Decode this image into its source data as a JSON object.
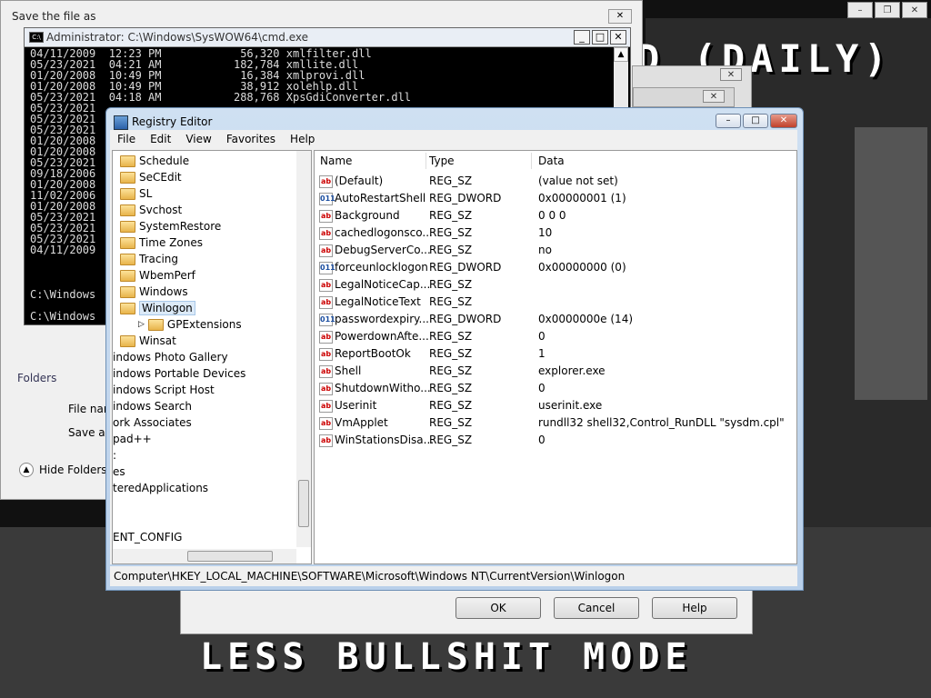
{
  "game": {
    "title_text": "D (DAILY)",
    "bottom_text": "LESS BULLSHIT MODE"
  },
  "save_dialog": {
    "title": "Save the file as",
    "close": "✕",
    "folders": "Folders",
    "file_name_label": "File name:",
    "save_type_label": "Save as type:",
    "hide_folders": "Hide Folders"
  },
  "cmd": {
    "title": "Administrator: C:\\Windows\\SysWOW64\\cmd.exe",
    "lines": [
      "04/11/2009  12:23 PM            56,320 xmlfilter.dll",
      "05/23/2021  04:21 AM           182,784 xmllite.dll",
      "01/20/2008  10:49 PM            16,384 xmlprovi.dll",
      "01/20/2008  10:49 PM            38,912 xolehlp.dll",
      "05/23/2021  04:18 AM           288,768 XpsGdiConverter.dll",
      "05/23/2021",
      "05/23/2021",
      "05/23/2021",
      "01/20/2008",
      "01/20/2008",
      "05/23/2021",
      "09/18/2006",
      "01/20/2008",
      "11/02/2006",
      "01/20/2008",
      "05/23/2021",
      "05/23/2021",
      "05/23/2021",
      "04/11/2009"
    ],
    "prompt1": "C:\\Windows",
    "prompt2": "C:\\Windows"
  },
  "regedit": {
    "title": "Registry Editor",
    "menu": [
      "File",
      "Edit",
      "View",
      "Favorites",
      "Help"
    ],
    "tree": [
      {
        "label": "Schedule",
        "indent": 1
      },
      {
        "label": "SeCEdit",
        "indent": 1
      },
      {
        "label": "SL",
        "indent": 1
      },
      {
        "label": "Svchost",
        "indent": 1
      },
      {
        "label": "SystemRestore",
        "indent": 1
      },
      {
        "label": "Time Zones",
        "indent": 1
      },
      {
        "label": "Tracing",
        "indent": 1
      },
      {
        "label": "WbemPerf",
        "indent": 1
      },
      {
        "label": "Windows",
        "indent": 1
      },
      {
        "label": "Winlogon",
        "indent": 1,
        "selected": true
      },
      {
        "label": "GPExtensions",
        "indent": 2
      },
      {
        "label": "Winsat",
        "indent": 1
      },
      {
        "label": "indows Photo Gallery",
        "indent": 0
      },
      {
        "label": "indows Portable Devices",
        "indent": 0
      },
      {
        "label": "indows Script Host",
        "indent": 0
      },
      {
        "label": "indows Search",
        "indent": 0
      },
      {
        "label": "ork Associates",
        "indent": 0
      },
      {
        "label": "pad++",
        "indent": 0
      },
      {
        "label": ":",
        "indent": 0
      },
      {
        "label": "es",
        "indent": 0
      },
      {
        "label": "teredApplications",
        "indent": 0
      },
      {
        "label": "",
        "indent": 0
      },
      {
        "label": "",
        "indent": 0
      },
      {
        "label": "ENT_CONFIG",
        "indent": 0
      }
    ],
    "columns": {
      "name": "Name",
      "type": "Type",
      "data": "Data"
    },
    "values": [
      {
        "name": "(Default)",
        "type": "REG_SZ",
        "data": "(value not set)",
        "icon": "ab"
      },
      {
        "name": "AutoRestartShell",
        "type": "REG_DWORD",
        "data": "0x00000001 (1)",
        "icon": "bin"
      },
      {
        "name": "Background",
        "type": "REG_SZ",
        "data": "0 0 0",
        "icon": "ab"
      },
      {
        "name": "cachedlogonsco...",
        "type": "REG_SZ",
        "data": "10",
        "icon": "ab"
      },
      {
        "name": "DebugServerCo...",
        "type": "REG_SZ",
        "data": "no",
        "icon": "ab"
      },
      {
        "name": "forceunlocklogon",
        "type": "REG_DWORD",
        "data": "0x00000000 (0)",
        "icon": "bin"
      },
      {
        "name": "LegalNoticeCap...",
        "type": "REG_SZ",
        "data": "",
        "icon": "ab"
      },
      {
        "name": "LegalNoticeText",
        "type": "REG_SZ",
        "data": "",
        "icon": "ab"
      },
      {
        "name": "passwordexpiry...",
        "type": "REG_DWORD",
        "data": "0x0000000e (14)",
        "icon": "bin"
      },
      {
        "name": "PowerdownAfte...",
        "type": "REG_SZ",
        "data": "0",
        "icon": "ab"
      },
      {
        "name": "ReportBootOk",
        "type": "REG_SZ",
        "data": "1",
        "icon": "ab"
      },
      {
        "name": "Shell",
        "type": "REG_SZ",
        "data": "explorer.exe",
        "icon": "ab"
      },
      {
        "name": "ShutdownWitho...",
        "type": "REG_SZ",
        "data": "0",
        "icon": "ab"
      },
      {
        "name": "Userinit",
        "type": "REG_SZ",
        "data": "userinit.exe",
        "icon": "ab"
      },
      {
        "name": "VmApplet",
        "type": "REG_SZ",
        "data": "rundll32 shell32,Control_RunDLL \"sysdm.cpl\"",
        "icon": "ab"
      },
      {
        "name": "WinStationsDisa...",
        "type": "REG_SZ",
        "data": "0",
        "icon": "ab"
      }
    ],
    "status_path": "Computer\\HKEY_LOCAL_MACHINE\\SOFTWARE\\Microsoft\\Windows NT\\CurrentVersion\\Winlogon"
  },
  "prop_dialog": {
    "ok": "OK",
    "cancel": "Cancel",
    "help": "Help"
  }
}
